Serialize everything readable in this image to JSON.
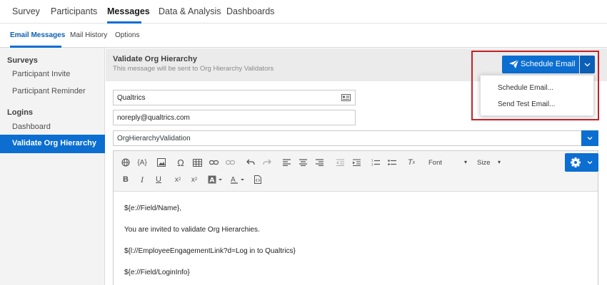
{
  "top_nav": {
    "tabs": [
      "Survey",
      "Participants",
      "Messages",
      "Data & Analysis",
      "Dashboards"
    ],
    "active": "Messages"
  },
  "sub_nav": {
    "tabs": [
      "Email Messages",
      "Mail History",
      "Options"
    ],
    "active": "Email Messages"
  },
  "sidebar": {
    "surveys_heading": "Surveys",
    "participant_invite": "Participant Invite",
    "participant_reminder": "Participant Reminder",
    "logins_heading": "Logins",
    "dashboard": "Dashboard",
    "validate_org": "Validate Org Hierarchy"
  },
  "message": {
    "title": "Validate Org Hierarchy",
    "subtitle": "This message will be sent to Org Hierarchy Validators"
  },
  "schedule": {
    "button_label": "Schedule Email",
    "options": [
      "Schedule Email...",
      "Send Test Email..."
    ]
  },
  "fields": {
    "from_name": "Qualtrics",
    "from_email": "noreply@qualtrics.com",
    "subject": "OrgHierarchyValidation"
  },
  "toolbar": {
    "font_label": "Font",
    "size_label": "Size"
  },
  "body": {
    "line1": "${e://Field/Name},",
    "line2": "You are invited to validate Org Hierarchies.",
    "line3": "${l://EmployeeEngagementLink?d=Log in to Qualtrics}",
    "line4": "${e://Field/LoginInfo}"
  },
  "colors": {
    "accent": "#0b6ed0",
    "highlight_box": "#c62026"
  }
}
